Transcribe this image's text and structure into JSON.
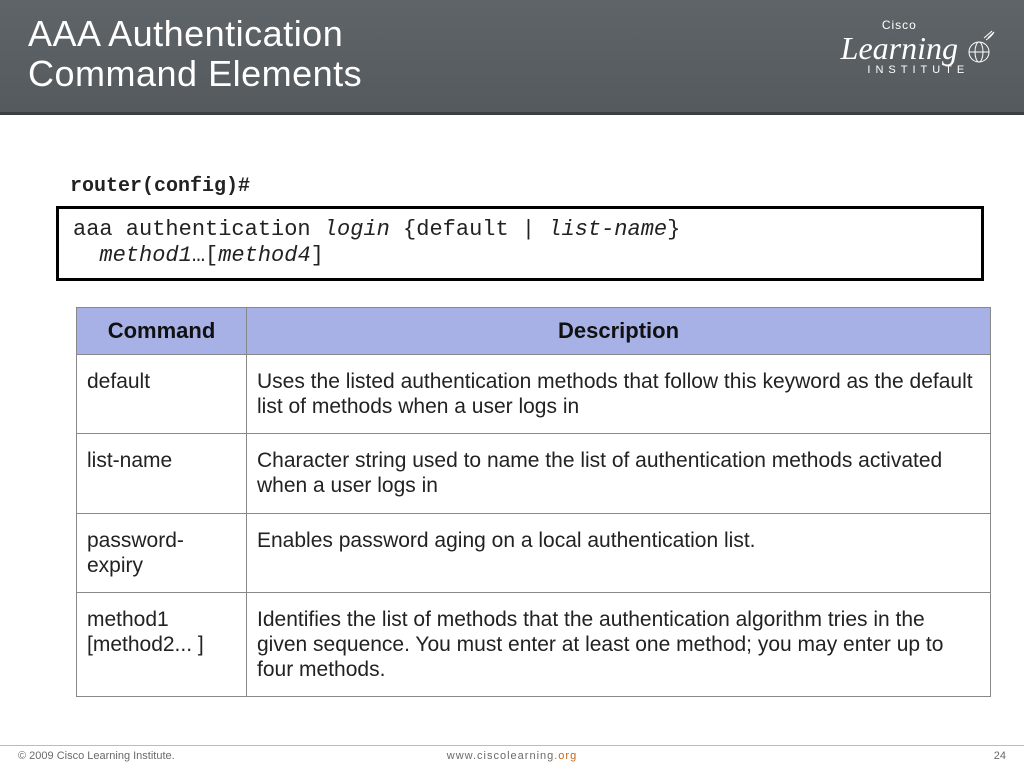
{
  "header": {
    "title_line1": "AAA Authentication",
    "title_line2": "Command Elements",
    "logo_brand": "Cisco",
    "logo_main": "Learning",
    "logo_sub": "INSTITUTE"
  },
  "prompt": "router(config)#",
  "command_syntax": {
    "prefix": "aaa authentication ",
    "italic1": "login",
    "mid": " {default | ",
    "italic2": "list-name",
    "close": "}",
    "line2_indent": "  ",
    "method": "method1",
    "ellipsis": "…[",
    "method_end": "method4",
    "close2": "]"
  },
  "table": {
    "headers": [
      "Command",
      "Description"
    ],
    "rows": [
      {
        "command": "default",
        "italic": false,
        "description": "Uses the listed authentication methods that follow this keyword as the default list of methods when a user logs in"
      },
      {
        "command": "list-name",
        "italic": false,
        "description": "Character string used to name the list of authentication methods activated when a user logs in"
      },
      {
        "command": "password-expiry",
        "italic": false,
        "description": "Enables password aging on a local authentication list."
      },
      {
        "command": "method1 [method2... ]",
        "italic": true,
        "description": "Identifies the list of methods that the authentication algorithm tries in the given sequence. You must enter at least one method; you may enter up to four methods."
      }
    ]
  },
  "footer": {
    "copyright": "© 2009 Cisco Learning Institute.",
    "url_pre": "www.ciscolearning",
    "url_suf": ".org",
    "page": "24"
  }
}
